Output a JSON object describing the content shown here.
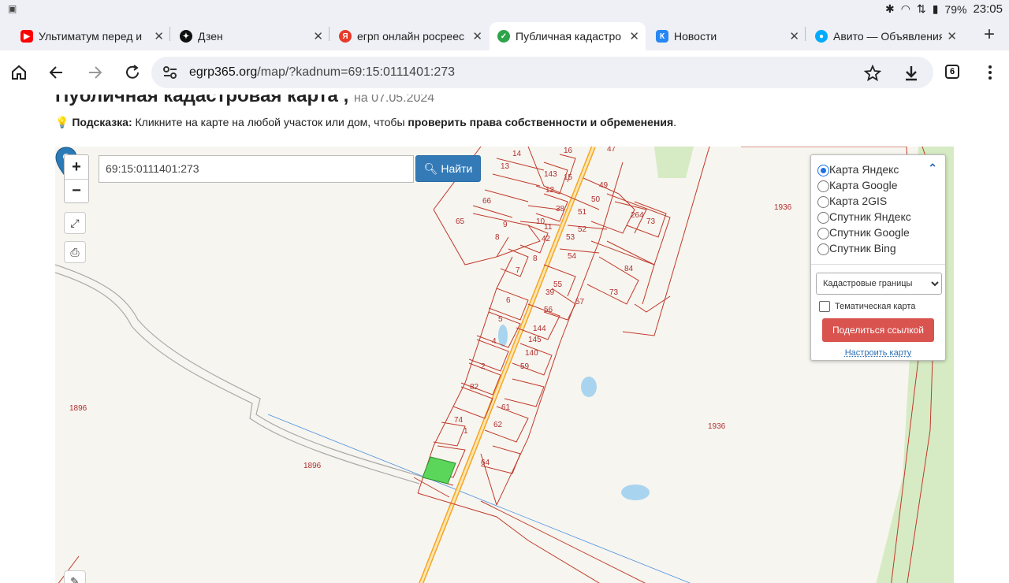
{
  "status": {
    "battery": "79%",
    "time": "23:05"
  },
  "tabs": [
    {
      "title": "Ультиматум перед и",
      "icon": "youtube-icon",
      "color": "#ff0000"
    },
    {
      "title": "Дзен",
      "icon": "dzen-icon",
      "color": "#111111"
    },
    {
      "title": "егрп онлайн росреес",
      "icon": "yandex-icon",
      "color": "#e73b2a"
    },
    {
      "title": "Публичная кадастро",
      "icon": "check-icon",
      "color": "#2ea34a"
    },
    {
      "title": "Новости",
      "icon": "vk-icon",
      "color": "#2787f5"
    },
    {
      "title": "Авито — Объявления",
      "icon": "avito-icon",
      "color": "#00aaff"
    }
  ],
  "address": {
    "domain": "egrp365.org",
    "path": "/map/?kadnum=69:15:0111401:273"
  },
  "tab_count": "6",
  "page": {
    "title": "Публичная кадастровая карта ,",
    "date": "на 07.05.2024",
    "hint_label": "Подсказка:",
    "hint_text": " Кликните на карте на любой участок или дом, чтобы ",
    "hint_bold": "проверить права собственности и обременения",
    "hint_end": "."
  },
  "map": {
    "search_value": "69:15:0111401:273",
    "search_button": "Найти",
    "zoom_in": "+",
    "zoom_out": "−",
    "layers": [
      {
        "label": "Карта Яндекс",
        "checked": true
      },
      {
        "label": "Карта Google",
        "checked": false
      },
      {
        "label": "Карта 2GIS",
        "checked": false
      },
      {
        "label": "Спутник Яндекс",
        "checked": false
      },
      {
        "label": "Спутник Google",
        "checked": false
      },
      {
        "label": "Спутник Bing",
        "checked": false
      }
    ],
    "overlay_select": "Кадастровые границы",
    "thematic_label": "Тематическая карта",
    "share_button": "Поделиться ссылкой",
    "setup_link": "Настроить карту",
    "labels": [
      {
        "text": "1936"
      },
      {
        "text": "1936"
      },
      {
        "text": "1896"
      },
      {
        "text": "1896"
      },
      {
        "text": "14"
      },
      {
        "text": "16"
      },
      {
        "text": "47"
      },
      {
        "text": "13"
      },
      {
        "text": "143"
      },
      {
        "text": "15"
      },
      {
        "text": "49"
      },
      {
        "text": "12"
      },
      {
        "text": "50"
      },
      {
        "text": "66"
      },
      {
        "text": "264"
      },
      {
        "text": "73"
      },
      {
        "text": "38"
      },
      {
        "text": "51"
      },
      {
        "text": "65"
      },
      {
        "text": "9"
      },
      {
        "text": "10"
      },
      {
        "text": "11"
      },
      {
        "text": "52"
      },
      {
        "text": "8"
      },
      {
        "text": "42"
      },
      {
        "text": "53"
      },
      {
        "text": "8"
      },
      {
        "text": "54"
      },
      {
        "text": "84"
      },
      {
        "text": "7"
      },
      {
        "text": "55"
      },
      {
        "text": "73"
      },
      {
        "text": "6"
      },
      {
        "text": "39"
      },
      {
        "text": "56"
      },
      {
        "text": "57"
      },
      {
        "text": "5"
      },
      {
        "text": "144"
      },
      {
        "text": "4"
      },
      {
        "text": "145"
      },
      {
        "text": "140"
      },
      {
        "text": "2"
      },
      {
        "text": "59"
      },
      {
        "text": "82"
      },
      {
        "text": "61"
      },
      {
        "text": "74"
      },
      {
        "text": "62"
      },
      {
        "text": "1"
      },
      {
        "text": "64"
      }
    ]
  }
}
